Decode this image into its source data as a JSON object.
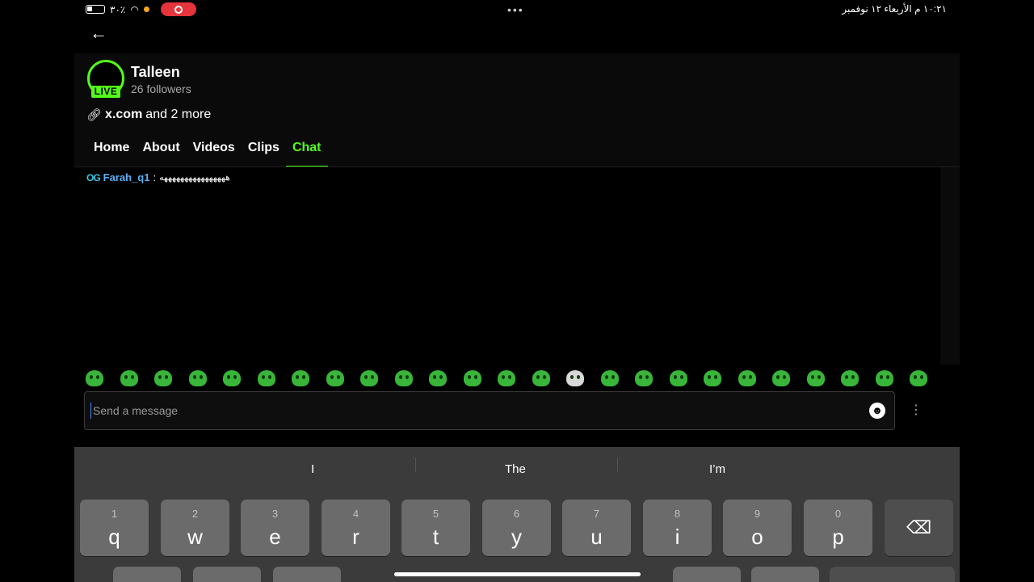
{
  "status_bar": {
    "battery_pct": "٣٠٪",
    "time_date": "١٠:٢١ م  الأربعاء ١٢ نوفمبر",
    "center_dots": "•••"
  },
  "channel": {
    "name": "Talleen",
    "followers": "26 followers",
    "live_label": "LIVE",
    "links_main": "x.com",
    "links_more": " and 2 more"
  },
  "tabs": [
    {
      "label": "Home"
    },
    {
      "label": "About"
    },
    {
      "label": "Videos"
    },
    {
      "label": "Clips"
    },
    {
      "label": "Chat"
    }
  ],
  "chat": {
    "messages": [
      {
        "badge": "OG",
        "user": "Farah_q1",
        "separator": ":",
        "text": "ههههههههههههههههه"
      }
    ]
  },
  "message_input": {
    "placeholder": "Send a message"
  },
  "keyboard": {
    "suggestions": [
      "I",
      "The",
      "I’m"
    ],
    "keys": [
      {
        "num": "1",
        "letter": "q"
      },
      {
        "num": "2",
        "letter": "w"
      },
      {
        "num": "3",
        "letter": "e"
      },
      {
        "num": "4",
        "letter": "r"
      },
      {
        "num": "5",
        "letter": "t"
      },
      {
        "num": "6",
        "letter": "y"
      },
      {
        "num": "7",
        "letter": "u"
      },
      {
        "num": "8",
        "letter": "i"
      },
      {
        "num": "9",
        "letter": "o"
      },
      {
        "num": "0",
        "letter": "p"
      }
    ]
  },
  "colors": {
    "accent": "#53fc18",
    "username": "#5ab0f7",
    "live_red": "#e5343c"
  }
}
